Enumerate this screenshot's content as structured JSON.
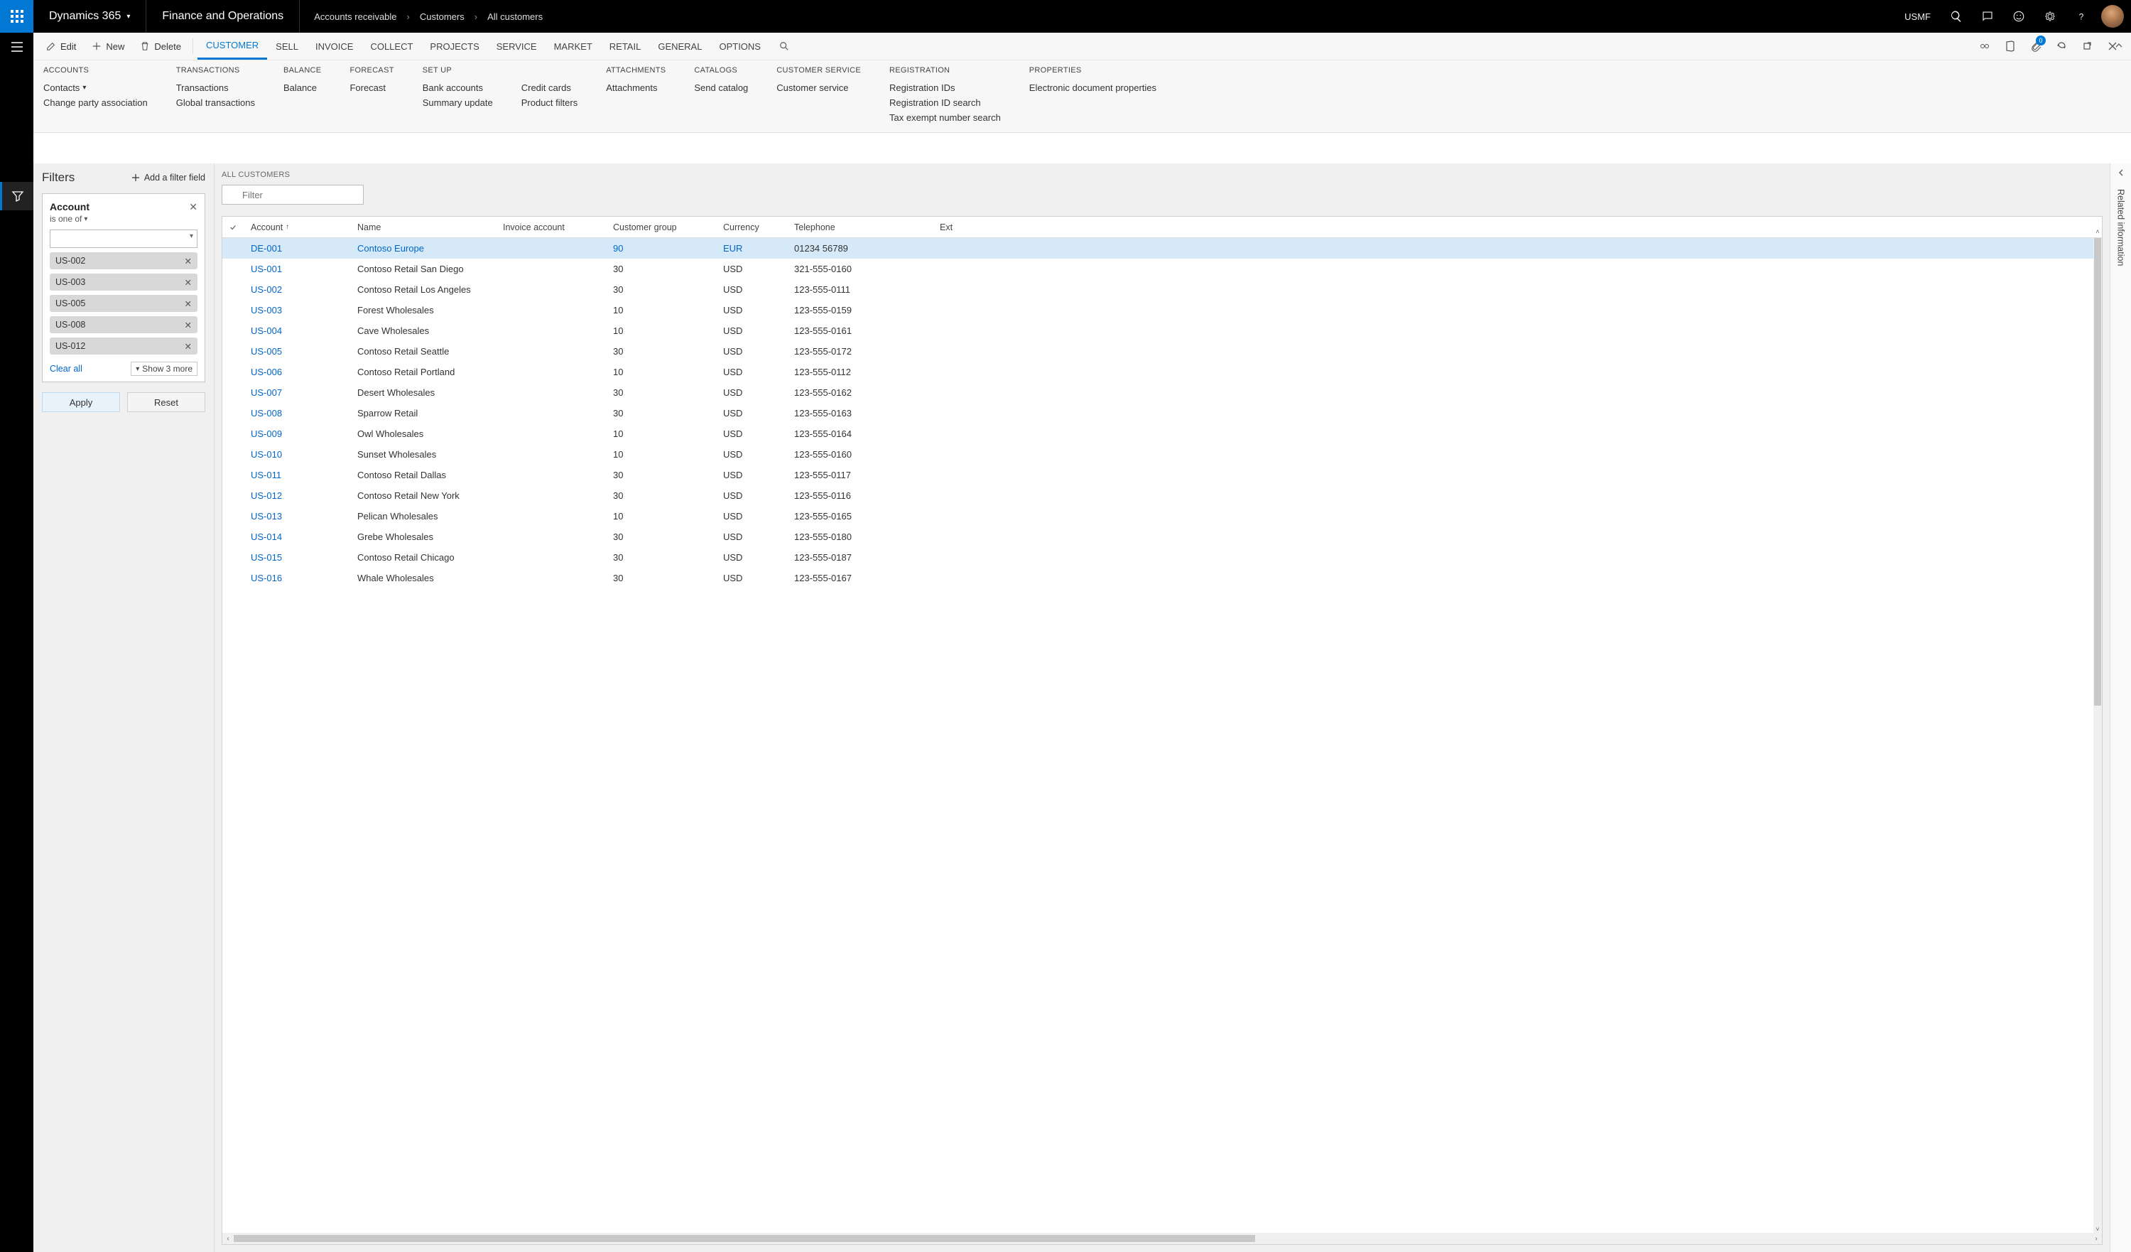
{
  "topbar": {
    "brand": "Dynamics 365",
    "module": "Finance and Operations",
    "breadcrumbs": [
      "Accounts receivable",
      "Customers",
      "All customers"
    ],
    "company": "USMF"
  },
  "actionbar": {
    "edit": "Edit",
    "new": "New",
    "delete": "Delete",
    "tabs": [
      "CUSTOMER",
      "SELL",
      "INVOICE",
      "COLLECT",
      "PROJECTS",
      "SERVICE",
      "MARKET",
      "RETAIL",
      "GENERAL",
      "OPTIONS"
    ],
    "selected_tab": "CUSTOMER",
    "attachment_count": "0"
  },
  "ribbon": {
    "groups": [
      {
        "title": "ACCOUNTS",
        "cols": [
          [
            "Contacts",
            "Change party association"
          ]
        ]
      },
      {
        "title": "TRANSACTIONS",
        "cols": [
          [
            "Transactions",
            "Global transactions"
          ]
        ]
      },
      {
        "title": "BALANCE",
        "cols": [
          [
            "Balance"
          ]
        ]
      },
      {
        "title": "FORECAST",
        "cols": [
          [
            "Forecast"
          ]
        ]
      },
      {
        "title": "SET UP",
        "cols": [
          [
            "Bank accounts",
            "Summary update"
          ],
          [
            "Credit cards",
            "Product filters"
          ]
        ]
      },
      {
        "title": "ATTACHMENTS",
        "cols": [
          [
            "Attachments"
          ]
        ]
      },
      {
        "title": "CATALOGS",
        "cols": [
          [
            "Send catalog"
          ]
        ]
      },
      {
        "title": "CUSTOMER SERVICE",
        "cols": [
          [
            "Customer service"
          ]
        ]
      },
      {
        "title": "REGISTRATION",
        "cols": [
          [
            "Registration IDs",
            "Registration ID search",
            "Tax exempt number search"
          ]
        ]
      },
      {
        "title": "PROPERTIES",
        "cols": [
          [
            "Electronic document properties"
          ]
        ]
      }
    ]
  },
  "filters": {
    "title": "Filters",
    "add_label": "Add a filter field",
    "card": {
      "field_label": "Account",
      "operator": "is one of",
      "chips": [
        "US-002",
        "US-003",
        "US-005",
        "US-008",
        "US-012"
      ],
      "clear": "Clear all",
      "show_more": "Show 3 more"
    },
    "apply": "Apply",
    "reset": "Reset"
  },
  "grid": {
    "title": "ALL CUSTOMERS",
    "filter_placeholder": "Filter",
    "columns": {
      "account": "Account",
      "name": "Name",
      "invoice": "Invoice account",
      "group": "Customer group",
      "currency": "Currency",
      "telephone": "Telephone",
      "ext": "Ext"
    },
    "rows": [
      {
        "account": "DE-001",
        "name": "Contoso Europe",
        "invoice": "",
        "group": "90",
        "currency": "EUR",
        "telephone": "01234 56789",
        "selected": true
      },
      {
        "account": "US-001",
        "name": "Contoso Retail San Diego",
        "invoice": "",
        "group": "30",
        "currency": "USD",
        "telephone": "321-555-0160"
      },
      {
        "account": "US-002",
        "name": "Contoso Retail Los Angeles",
        "invoice": "",
        "group": "30",
        "currency": "USD",
        "telephone": "123-555-0111"
      },
      {
        "account": "US-003",
        "name": "Forest Wholesales",
        "invoice": "",
        "group": "10",
        "currency": "USD",
        "telephone": "123-555-0159"
      },
      {
        "account": "US-004",
        "name": "Cave Wholesales",
        "invoice": "",
        "group": "10",
        "currency": "USD",
        "telephone": "123-555-0161"
      },
      {
        "account": "US-005",
        "name": "Contoso Retail Seattle",
        "invoice": "",
        "group": "30",
        "currency": "USD",
        "telephone": "123-555-0172"
      },
      {
        "account": "US-006",
        "name": "Contoso Retail Portland",
        "invoice": "",
        "group": "10",
        "currency": "USD",
        "telephone": "123-555-0112"
      },
      {
        "account": "US-007",
        "name": "Desert Wholesales",
        "invoice": "",
        "group": "30",
        "currency": "USD",
        "telephone": "123-555-0162"
      },
      {
        "account": "US-008",
        "name": "Sparrow Retail",
        "invoice": "",
        "group": "30",
        "currency": "USD",
        "telephone": "123-555-0163"
      },
      {
        "account": "US-009",
        "name": "Owl Wholesales",
        "invoice": "",
        "group": "10",
        "currency": "USD",
        "telephone": "123-555-0164"
      },
      {
        "account": "US-010",
        "name": "Sunset Wholesales",
        "invoice": "",
        "group": "10",
        "currency": "USD",
        "telephone": "123-555-0160"
      },
      {
        "account": "US-011",
        "name": "Contoso Retail Dallas",
        "invoice": "",
        "group": "30",
        "currency": "USD",
        "telephone": "123-555-0117"
      },
      {
        "account": "US-012",
        "name": "Contoso Retail New York",
        "invoice": "",
        "group": "30",
        "currency": "USD",
        "telephone": "123-555-0116"
      },
      {
        "account": "US-013",
        "name": "Pelican Wholesales",
        "invoice": "",
        "group": "10",
        "currency": "USD",
        "telephone": "123-555-0165"
      },
      {
        "account": "US-014",
        "name": "Grebe Wholesales",
        "invoice": "",
        "group": "30",
        "currency": "USD",
        "telephone": "123-555-0180"
      },
      {
        "account": "US-015",
        "name": "Contoso Retail Chicago",
        "invoice": "",
        "group": "30",
        "currency": "USD",
        "telephone": "123-555-0187"
      },
      {
        "account": "US-016",
        "name": "Whale Wholesales",
        "invoice": "",
        "group": "30",
        "currency": "USD",
        "telephone": "123-555-0167"
      }
    ]
  },
  "related_info": {
    "label": "Related information"
  }
}
